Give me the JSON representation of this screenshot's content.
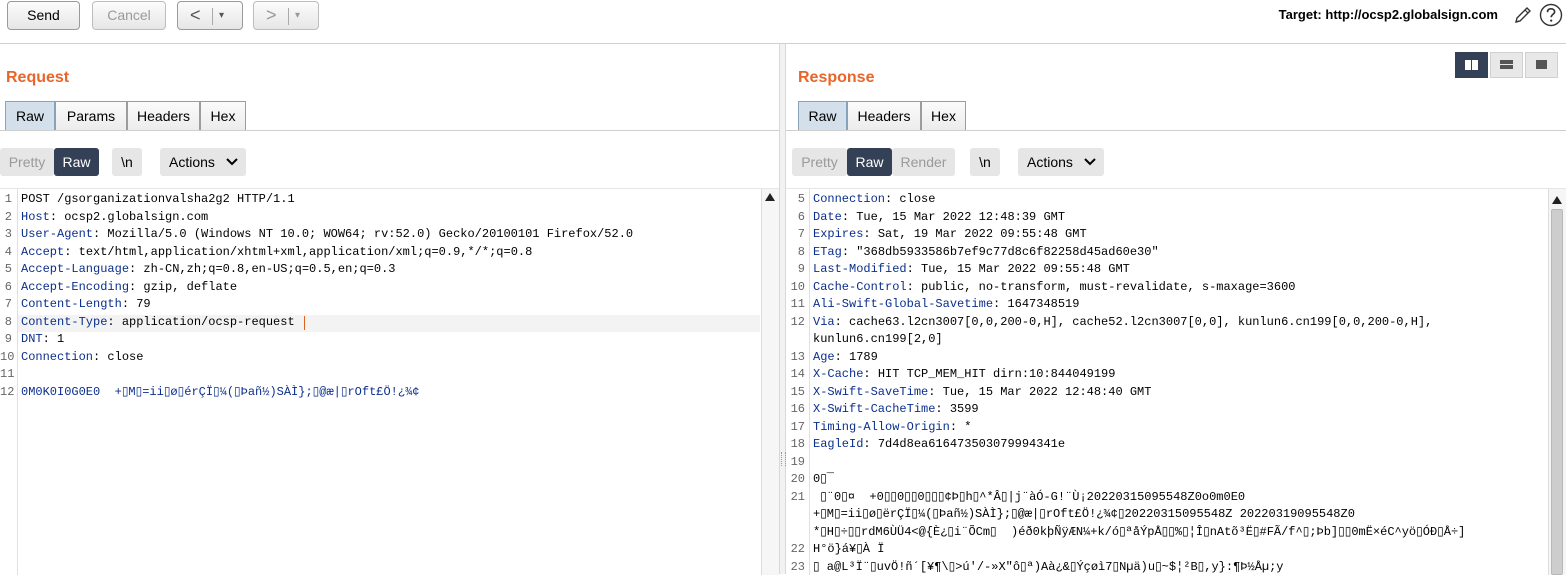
{
  "toolbar": {
    "send_label": "Send",
    "cancel_label": "Cancel",
    "back_glyph": "<",
    "forward_glyph": ">",
    "dropdown_glyph": "▾",
    "target_text": "Target: http://ocsp2.globalsign.com",
    "edit_icon": "pencil-icon",
    "help_icon": "help-icon"
  },
  "request": {
    "title": "Request",
    "tabs": [
      "Raw",
      "Params",
      "Headers",
      "Hex"
    ],
    "active_tab": "Raw",
    "view_buttons": {
      "pretty": "Pretty",
      "raw": "Raw",
      "newline": "\\n",
      "actions": "Actions"
    },
    "lines": [
      {
        "n": "1",
        "key": "",
        "text": "POST /gsorganizationvalsha2g2 HTTP/1.1"
      },
      {
        "n": "2",
        "key": "Host",
        "text": ": ocsp2.globalsign.com"
      },
      {
        "n": "3",
        "key": "User-Agent",
        "text": ": Mozilla/5.0 (Windows NT 10.0; WOW64; rv:52.0) Gecko/20100101 Firefox/52.0"
      },
      {
        "n": "4",
        "key": "Accept",
        "text": ": text/html,application/xhtml+xml,application/xml;q=0.9,*/*;q=0.8"
      },
      {
        "n": "5",
        "key": "Accept-Language",
        "text": ": zh-CN,zh;q=0.8,en-US;q=0.5,en;q=0.3"
      },
      {
        "n": "6",
        "key": "Accept-Encoding",
        "text": ": gzip, deflate"
      },
      {
        "n": "7",
        "key": "Content-Length",
        "text": ": 79"
      },
      {
        "n": "8",
        "key": "Content-Type",
        "text": ": application/ocsp-request"
      },
      {
        "n": "9",
        "key": "DNT",
        "text": ": 1"
      },
      {
        "n": "10",
        "key": "Connection",
        "text": ": close"
      },
      {
        "n": "11",
        "key": "",
        "text": ""
      },
      {
        "n": "12",
        "key": "",
        "text": "0M0K0I0G0E0  +▯M▯=ii▯ø▯érÇÏ▯¼(▯Þañ½)SÀÌ};▯@æ|▯rOft£Ö!¿¾¢"
      }
    ]
  },
  "response": {
    "title": "Response",
    "tabs": [
      "Raw",
      "Headers",
      "Hex"
    ],
    "active_tab": "Raw",
    "view_buttons": {
      "pretty": "Pretty",
      "raw": "Raw",
      "render": "Render",
      "newline": "\\n",
      "actions": "Actions"
    },
    "lines": [
      {
        "n": "5",
        "key": "Connection",
        "text": ": close"
      },
      {
        "n": "6",
        "key": "Date",
        "text": ": Tue, 15 Mar 2022 12:48:39 GMT"
      },
      {
        "n": "7",
        "key": "Expires",
        "text": ": Sat, 19 Mar 2022 09:55:48 GMT"
      },
      {
        "n": "8",
        "key": "ETag",
        "text": ": \"368db5933586b7ef9c77d8c6f82258d45ad60e30\""
      },
      {
        "n": "9",
        "key": "Last-Modified",
        "text": ": Tue, 15 Mar 2022 09:55:48 GMT"
      },
      {
        "n": "10",
        "key": "Cache-Control",
        "text": ": public, no-transform, must-revalidate, s-maxage=3600"
      },
      {
        "n": "11",
        "key": "Ali-Swift-Global-Savetime",
        "text": ": 1647348519"
      },
      {
        "n": "12",
        "key": "Via",
        "text": ": cache63.l2cn3007[0,0,200-0,H], cache52.l2cn3007[0,0], kunlun6.cn199[0,0,200-0,H],"
      },
      {
        "n": "",
        "key": "",
        "text": "kunlun6.cn199[2,0]"
      },
      {
        "n": "13",
        "key": "Age",
        "text": ": 1789"
      },
      {
        "n": "14",
        "key": "X-Cache",
        "text": ": HIT TCP_MEM_HIT dirn:10:844049199"
      },
      {
        "n": "15",
        "key": "X-Swift-SaveTime",
        "text": ": Tue, 15 Mar 2022 12:48:40 GMT"
      },
      {
        "n": "16",
        "key": "X-Swift-CacheTime",
        "text": ": 3599"
      },
      {
        "n": "17",
        "key": "Timing-Allow-Origin",
        "text": ": *"
      },
      {
        "n": "18",
        "key": "EagleId",
        "text": ": 7d4d8ea616473503079994341e"
      },
      {
        "n": "19",
        "key": "",
        "text": ""
      },
      {
        "n": "20",
        "key": "",
        "text": "0▯¯"
      },
      {
        "n": "21",
        "key": "",
        "text": " ▯¨0▯¤  +0▯▯0▯▯0▯▯▯¢Þ▯h▯^*Â▯|j¨àÓ-G!¨Ù¡20220315095548Z0o0m0E0"
      },
      {
        "n": "",
        "key": "",
        "text": "+▯M▯=ii▯ø▯ërÇÏ▯¼(▯Þañ½)SÀÌ};▯@æ|▯rOft£Ö!¿¾¢▯20220315095548Z 20220319095548Z0"
      },
      {
        "n": "",
        "key": "",
        "text": "*▯H▯÷▯▯rdM6ÙÜ4<@{È¿▯i¨ÕCm▯  )éð0kþÑÿÆN¼+k/ó▯ªåÝpÅ▯▯%▯¦Î▯nAtõ³Ë▯#FÃ/f^▯;Þb]▯▯0mË×éC^yö▯ÓÐ▯Å÷]"
      },
      {
        "n": "22",
        "key": "",
        "text": "H°ö}á¥▯À Ï"
      },
      {
        "n": "23",
        "key": "",
        "text": "▯ a@L³Ï¨▯uvÖ!ñ´[¥¶\\▯>ú'/-»X\"ô▯ª)Aà¿&▯Ýçøì7▯Nµä)u▯~$¦²B▯,y}:¶Þ½Åµ;y"
      }
    ]
  }
}
